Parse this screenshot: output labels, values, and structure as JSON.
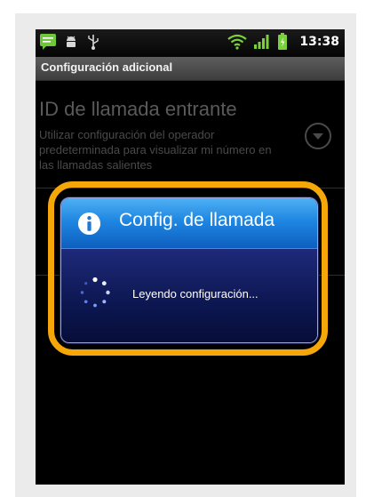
{
  "status_bar": {
    "time": "13:38",
    "icons": [
      "message-icon",
      "android-debug-icon",
      "usb-icon",
      "wifi-icon",
      "signal-icon",
      "battery-icon"
    ]
  },
  "title_bar": {
    "title": "Configuración adicional"
  },
  "settings": {
    "caller_id": {
      "title": "ID de llamada entrante",
      "description": "Utilizar configuración del operador predeterminada para visualizar mi número en las llamadas salientes"
    }
  },
  "dialog": {
    "title": "Config. de llamada",
    "message": "Leyendo configuración..."
  },
  "colors": {
    "highlight": "#f5a70a",
    "dialog_header": "#1f86e2",
    "dialog_body": "#0c1650"
  }
}
